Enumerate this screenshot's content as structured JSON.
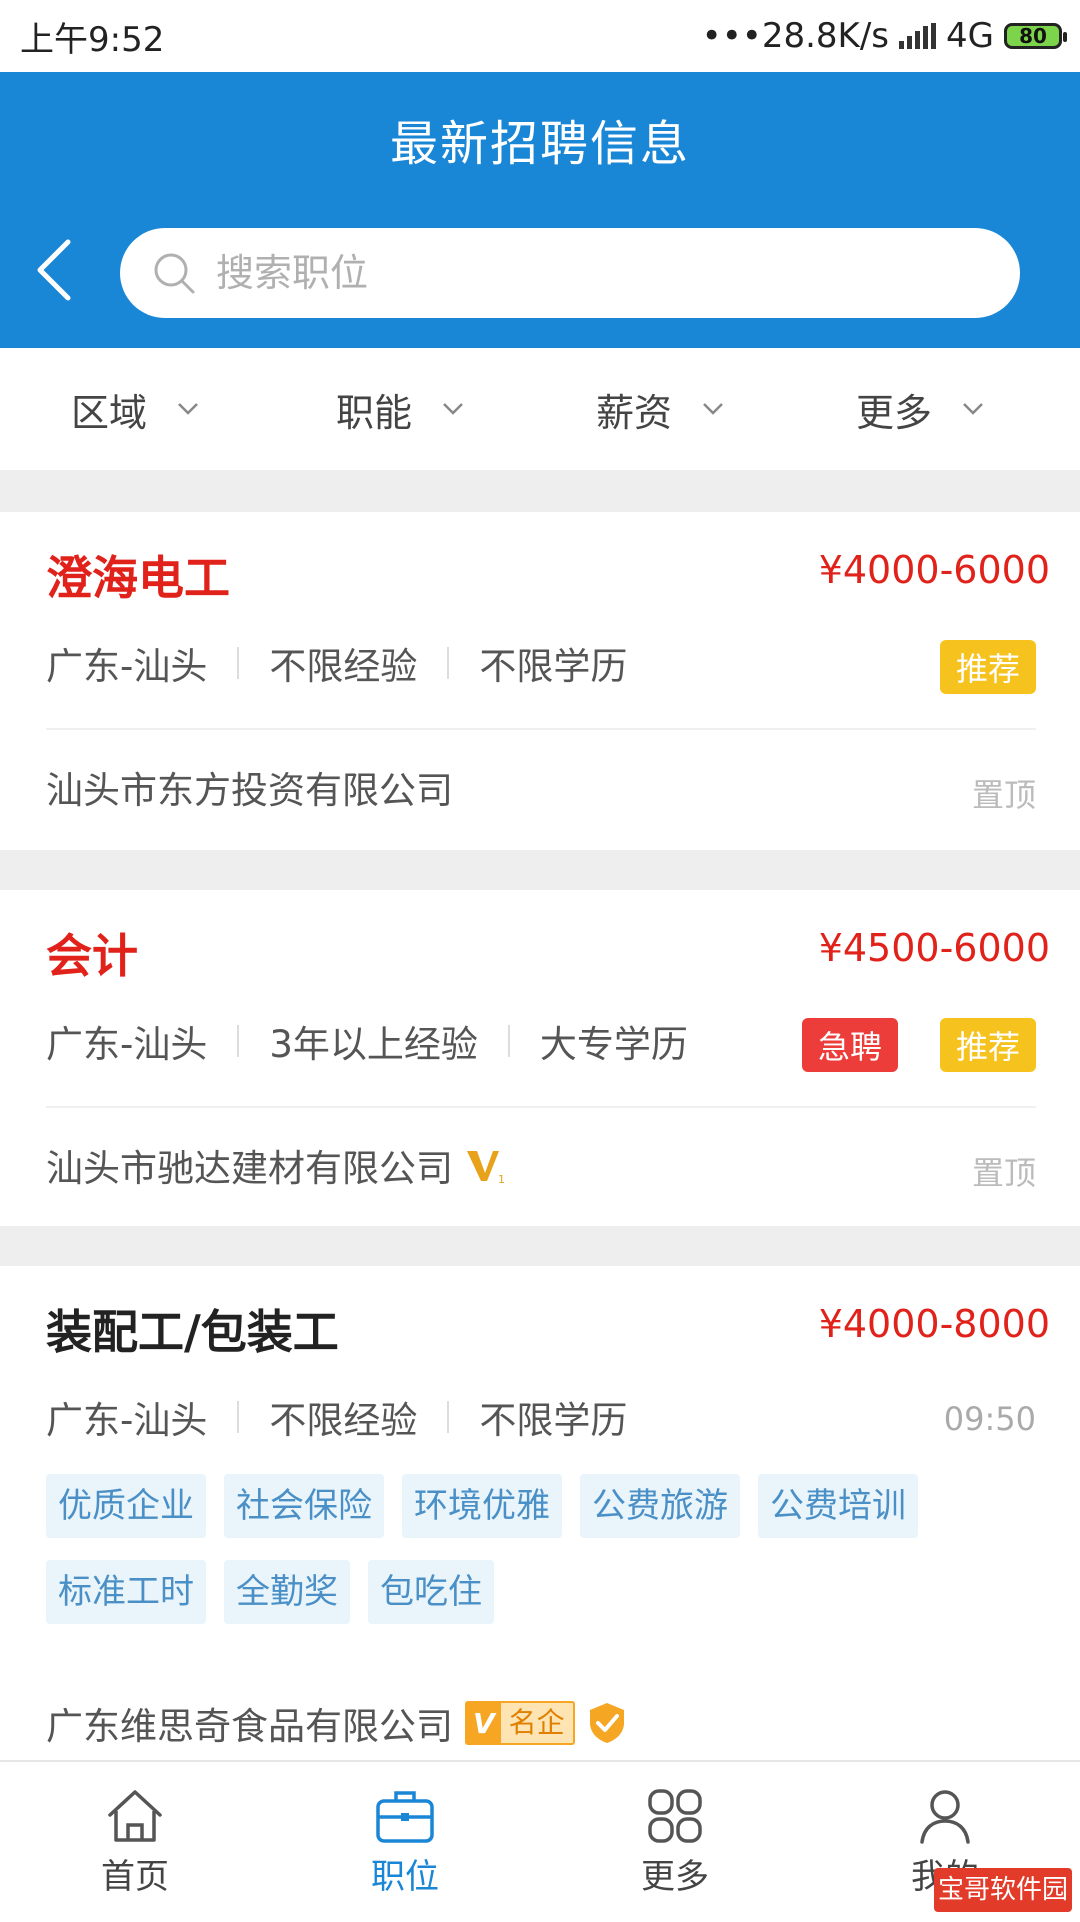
{
  "status_bar": {
    "time": "上午9:52",
    "network_speed": "•••28.8K/s",
    "network_type": "4G",
    "battery": "80"
  },
  "header": {
    "title": "最新招聘信息",
    "search_placeholder": "搜索职位"
  },
  "filters": [
    {
      "label": "区域"
    },
    {
      "label": "职能"
    },
    {
      "label": "薪资"
    },
    {
      "label": "更多"
    }
  ],
  "jobs": [
    {
      "title": "澄海电工",
      "salary": "¥4000-6000",
      "location": "广东-汕头",
      "experience": "不限经验",
      "education": "不限学历",
      "badges": [
        "推荐"
      ],
      "company": "汕头市东方投资有限公司",
      "pin": "置顶"
    },
    {
      "title": "会计",
      "salary": "¥4500-6000",
      "location": "广东-汕头",
      "experience": "3年以上经验",
      "education": "大专学历",
      "badges": [
        "急聘",
        "推荐"
      ],
      "company": "汕头市驰达建材有限公司",
      "pin": "置顶"
    },
    {
      "title": "装配工/包装工",
      "salary": "¥4000-8000",
      "location": "广东-汕头",
      "experience": "不限经验",
      "education": "不限学历",
      "time": "09:50",
      "tags": [
        "优质企业",
        "社会保险",
        "环境优雅",
        "公费旅游",
        "公费培训",
        "标准工时",
        "全勤奖",
        "包吃住"
      ],
      "company": "广东维思奇食品有限公司",
      "company_badge": "名企"
    }
  ],
  "tabbar": [
    {
      "label": "首页",
      "icon": "home-icon"
    },
    {
      "label": "职位",
      "icon": "briefcase-icon"
    },
    {
      "label": "更多",
      "icon": "grid-icon"
    },
    {
      "label": "我的",
      "icon": "user-icon"
    }
  ],
  "watermark": "宝哥软件园",
  "colors": {
    "primary": "#1a86d6",
    "salary_red": "#e1221b",
    "badge_yellow": "#f6c21d",
    "badge_red": "#ed3d3b"
  }
}
